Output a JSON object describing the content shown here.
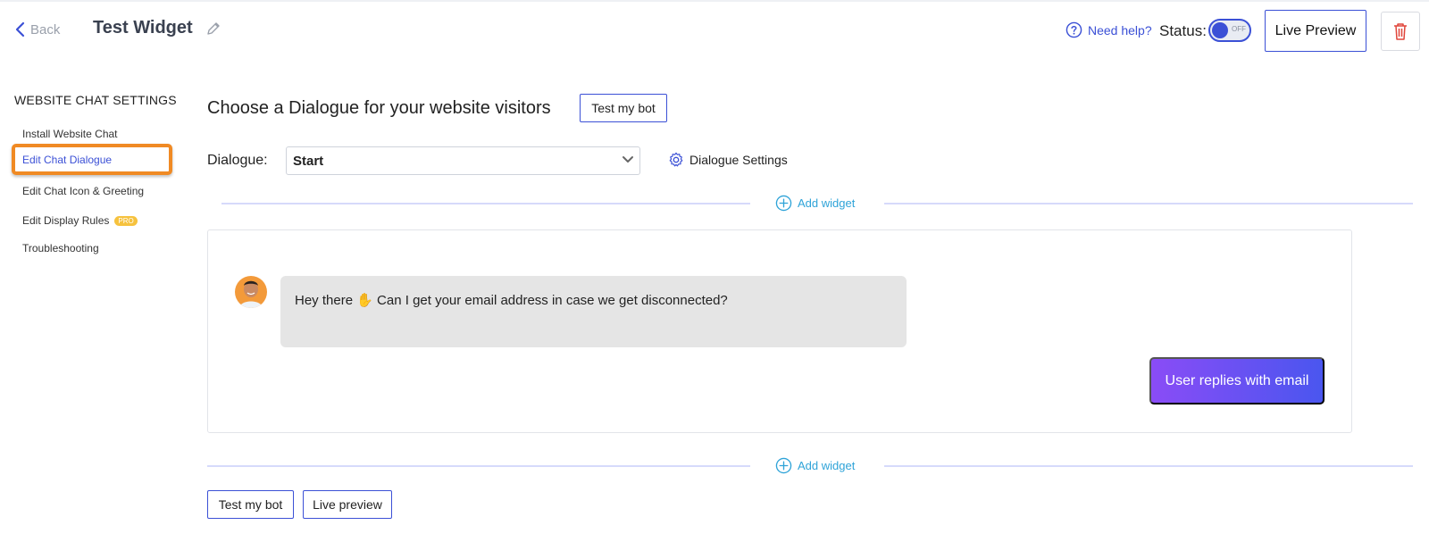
{
  "header": {
    "back_label": "Back",
    "title": "Test Widget",
    "help_label": "Need help?",
    "status_label": "Status:",
    "toggle_text": "OFF",
    "live_preview_label": "Live Preview"
  },
  "sidebar": {
    "heading": "WEBSITE CHAT SETTINGS",
    "items": [
      {
        "label": "Install Website Chat"
      },
      {
        "label": "Edit Chat Dialogue"
      },
      {
        "label": "Edit Chat Icon & Greeting"
      },
      {
        "label": "Edit Display Rules",
        "badge": "PRO"
      },
      {
        "label": "Troubleshooting"
      }
    ]
  },
  "main": {
    "heading": "Choose a Dialogue for your website visitors",
    "test_bot_label": "Test my bot",
    "dialogue_label": "Dialogue:",
    "dialogue_value": "Start",
    "dialogue_settings_label": "Dialogue Settings",
    "add_widget_label": "Add widget",
    "message_text": "Hey there ✋ Can I get your email address in case we get disconnected?",
    "reply_button_label": "User replies with email",
    "footer": {
      "test_bot_label": "Test my bot",
      "live_preview_label": "Live preview"
    }
  },
  "colors": {
    "accent": "#3b50d6",
    "highlight_border": "#f08a24",
    "link_blue": "#2ea3d8",
    "reply_gradient_start": "#8a4cf6",
    "reply_gradient_end": "#4a56ef",
    "delete_red": "#e0453a"
  }
}
